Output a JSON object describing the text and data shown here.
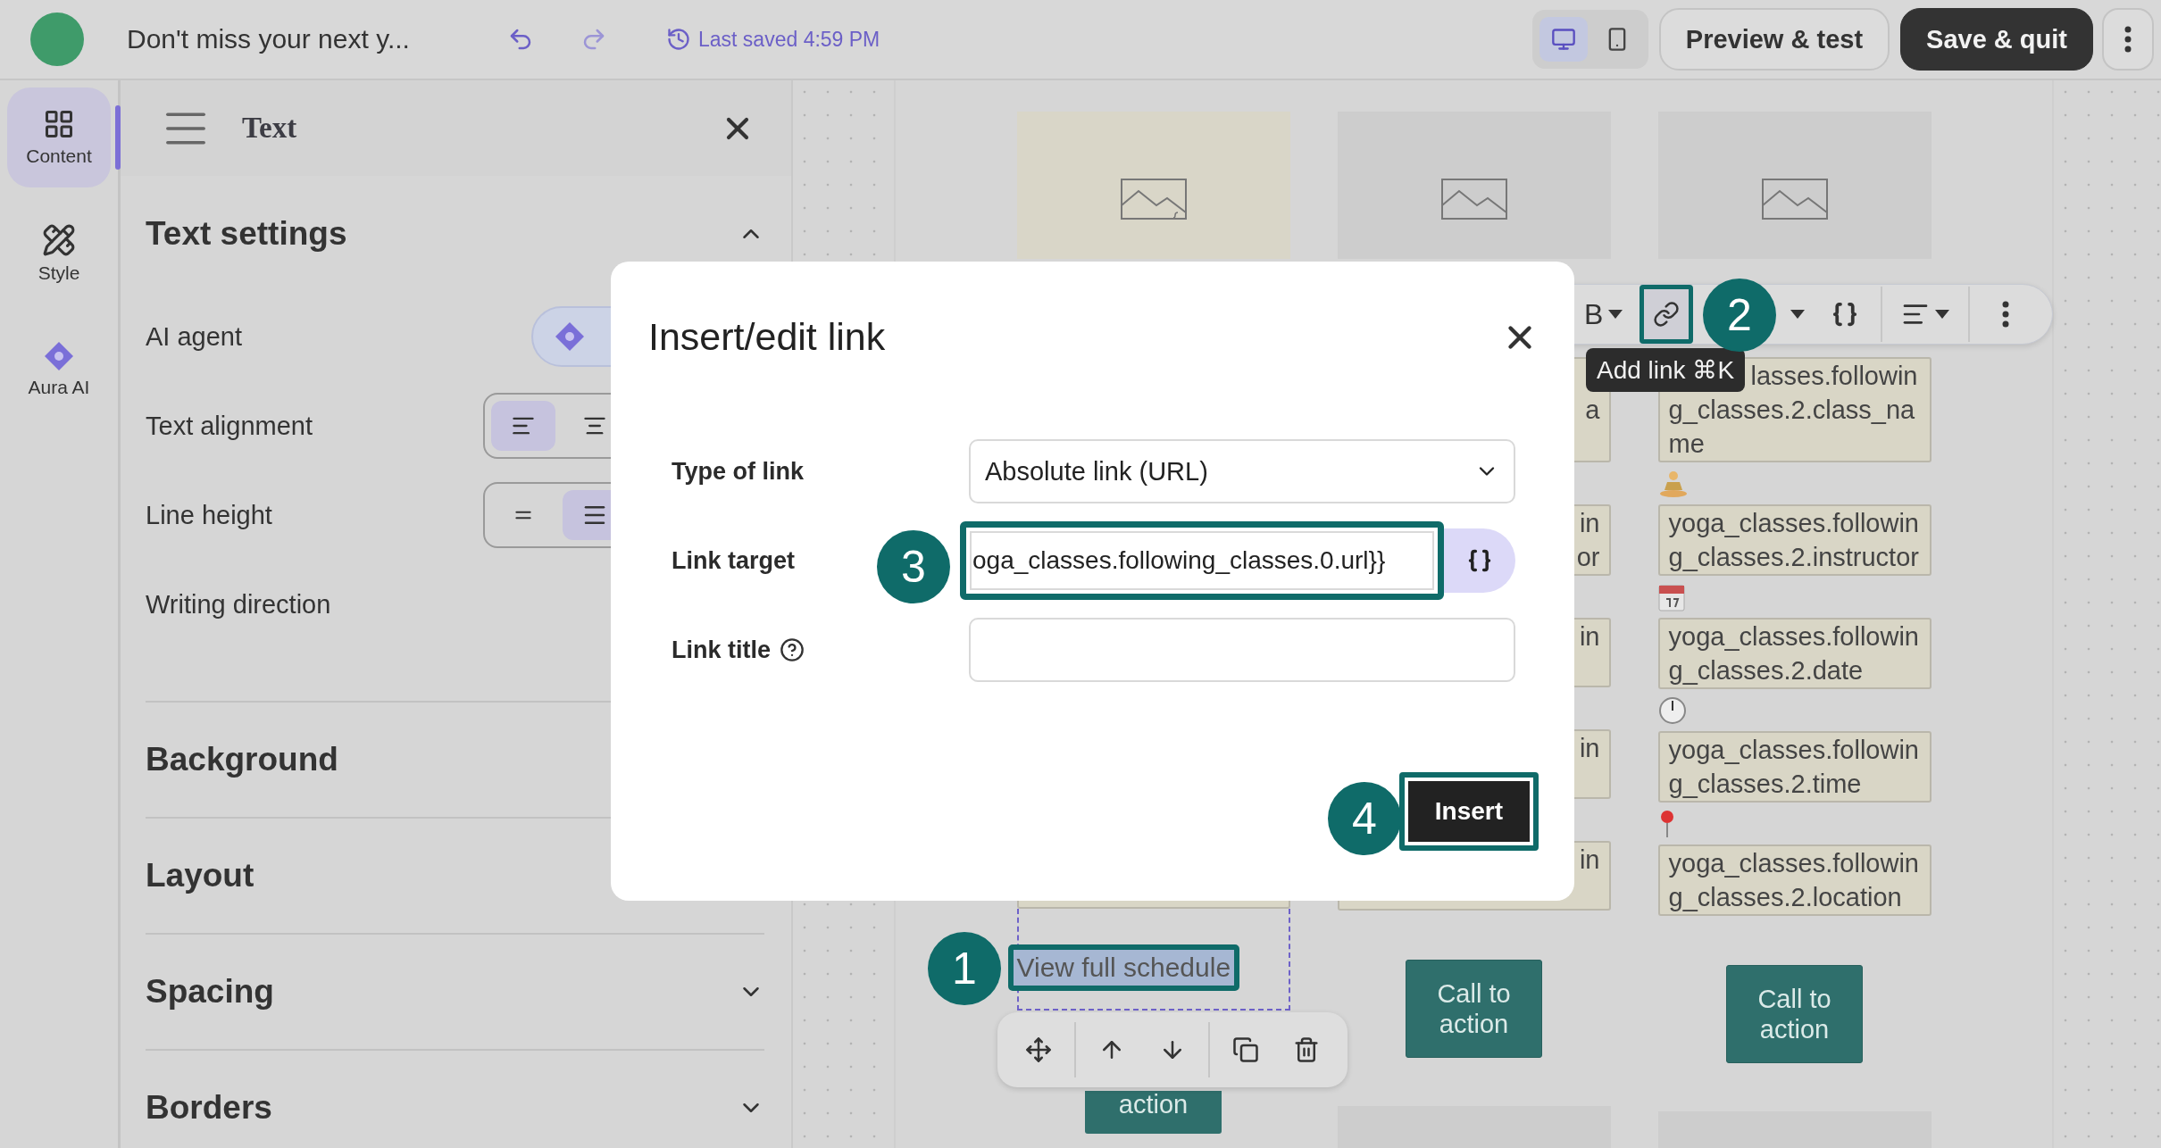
{
  "topbar": {
    "title": "Don't miss your next y...",
    "saved": "Last saved 4:59 PM",
    "devices": [
      {
        "kind": "desktop",
        "selected": true
      },
      {
        "kind": "mobile",
        "selected": false
      }
    ],
    "preview_button": "Preview & test",
    "save_button": "Save & quit"
  },
  "rail": [
    {
      "kind": "content",
      "label": "Content",
      "selected": true
    },
    {
      "kind": "style",
      "label": "Style",
      "selected": false
    },
    {
      "kind": "aura",
      "label": "Aura AI",
      "selected": false
    }
  ],
  "panel": {
    "title": "Text",
    "section": {
      "title": "Text settings",
      "expanded": true,
      "rows": [
        {
          "kind": "ai",
          "label": "AI agent"
        },
        {
          "kind": "align",
          "label": "Text alignment",
          "options": [
            {
              "selected": true
            },
            {
              "selected": false
            }
          ]
        },
        {
          "kind": "lineheight",
          "label": "Line height",
          "options": [
            {
              "selected": false
            },
            {
              "selected": true
            }
          ]
        },
        {
          "kind": "plain",
          "label": "Writing direction"
        }
      ]
    },
    "sections": [
      {
        "title": "Background"
      },
      {
        "title": "Layout"
      },
      {
        "title": "Spacing",
        "expanded": false
      },
      {
        "title": "Borders",
        "expanded": false
      }
    ]
  },
  "column_1": {
    "selected_text": "View full schedule",
    "highlighted": true,
    "button_fragment": "action"
  },
  "column_2": {
    "fragments": [
      "\na",
      "in\nor",
      "in",
      "in",
      "in"
    ],
    "button": "Call to action"
  },
  "column_3": {
    "fields": [
      {
        "kind": "covered",
        "text": "lasses.following_classes.2.class_name"
      },
      {
        "kind": "meditation",
        "text": "yoga_classes.following_classes.2.instructor"
      },
      {
        "kind": "calendar",
        "text": "yoga_classes.following_classes.2.date"
      },
      {
        "kind": "clock",
        "text": "yoga_classes.following_classes.2.time"
      },
      {
        "kind": "pin",
        "text": "yoga_classes.following_classes.2.location"
      }
    ],
    "button": "Call to action"
  },
  "format_toolbar": {
    "items": [
      {
        "kind": "bold",
        "label": "B",
        "caret": true,
        "highlighted": false
      },
      {
        "kind": "link",
        "caret": false,
        "highlighted": true
      },
      {
        "kind": "covered",
        "caret": true,
        "highlighted": false
      },
      {
        "kind": "braces",
        "caret": false,
        "highlighted": false
      },
      {
        "kind": "align",
        "caret": true,
        "highlighted": false
      },
      {
        "kind": "more",
        "caret": false,
        "highlighted": false
      }
    ],
    "tooltip": "Add link ⌘K"
  },
  "dialog": {
    "title": "Insert/edit link",
    "fields": [
      {
        "kind": "select",
        "label": "Type of link",
        "value": "Absolute link (URL)",
        "highlighted": false
      },
      {
        "kind": "variable",
        "label": "Link target",
        "value": "oga_classes.following_classes.0.url}}",
        "highlighted": true
      },
      {
        "kind": "input",
        "label": "Link title",
        "help": true,
        "highlighted": false
      }
    ],
    "insert_button": "Insert",
    "insert_highlighted": true
  },
  "annotations": [
    "1",
    "2",
    "3",
    "4"
  ]
}
